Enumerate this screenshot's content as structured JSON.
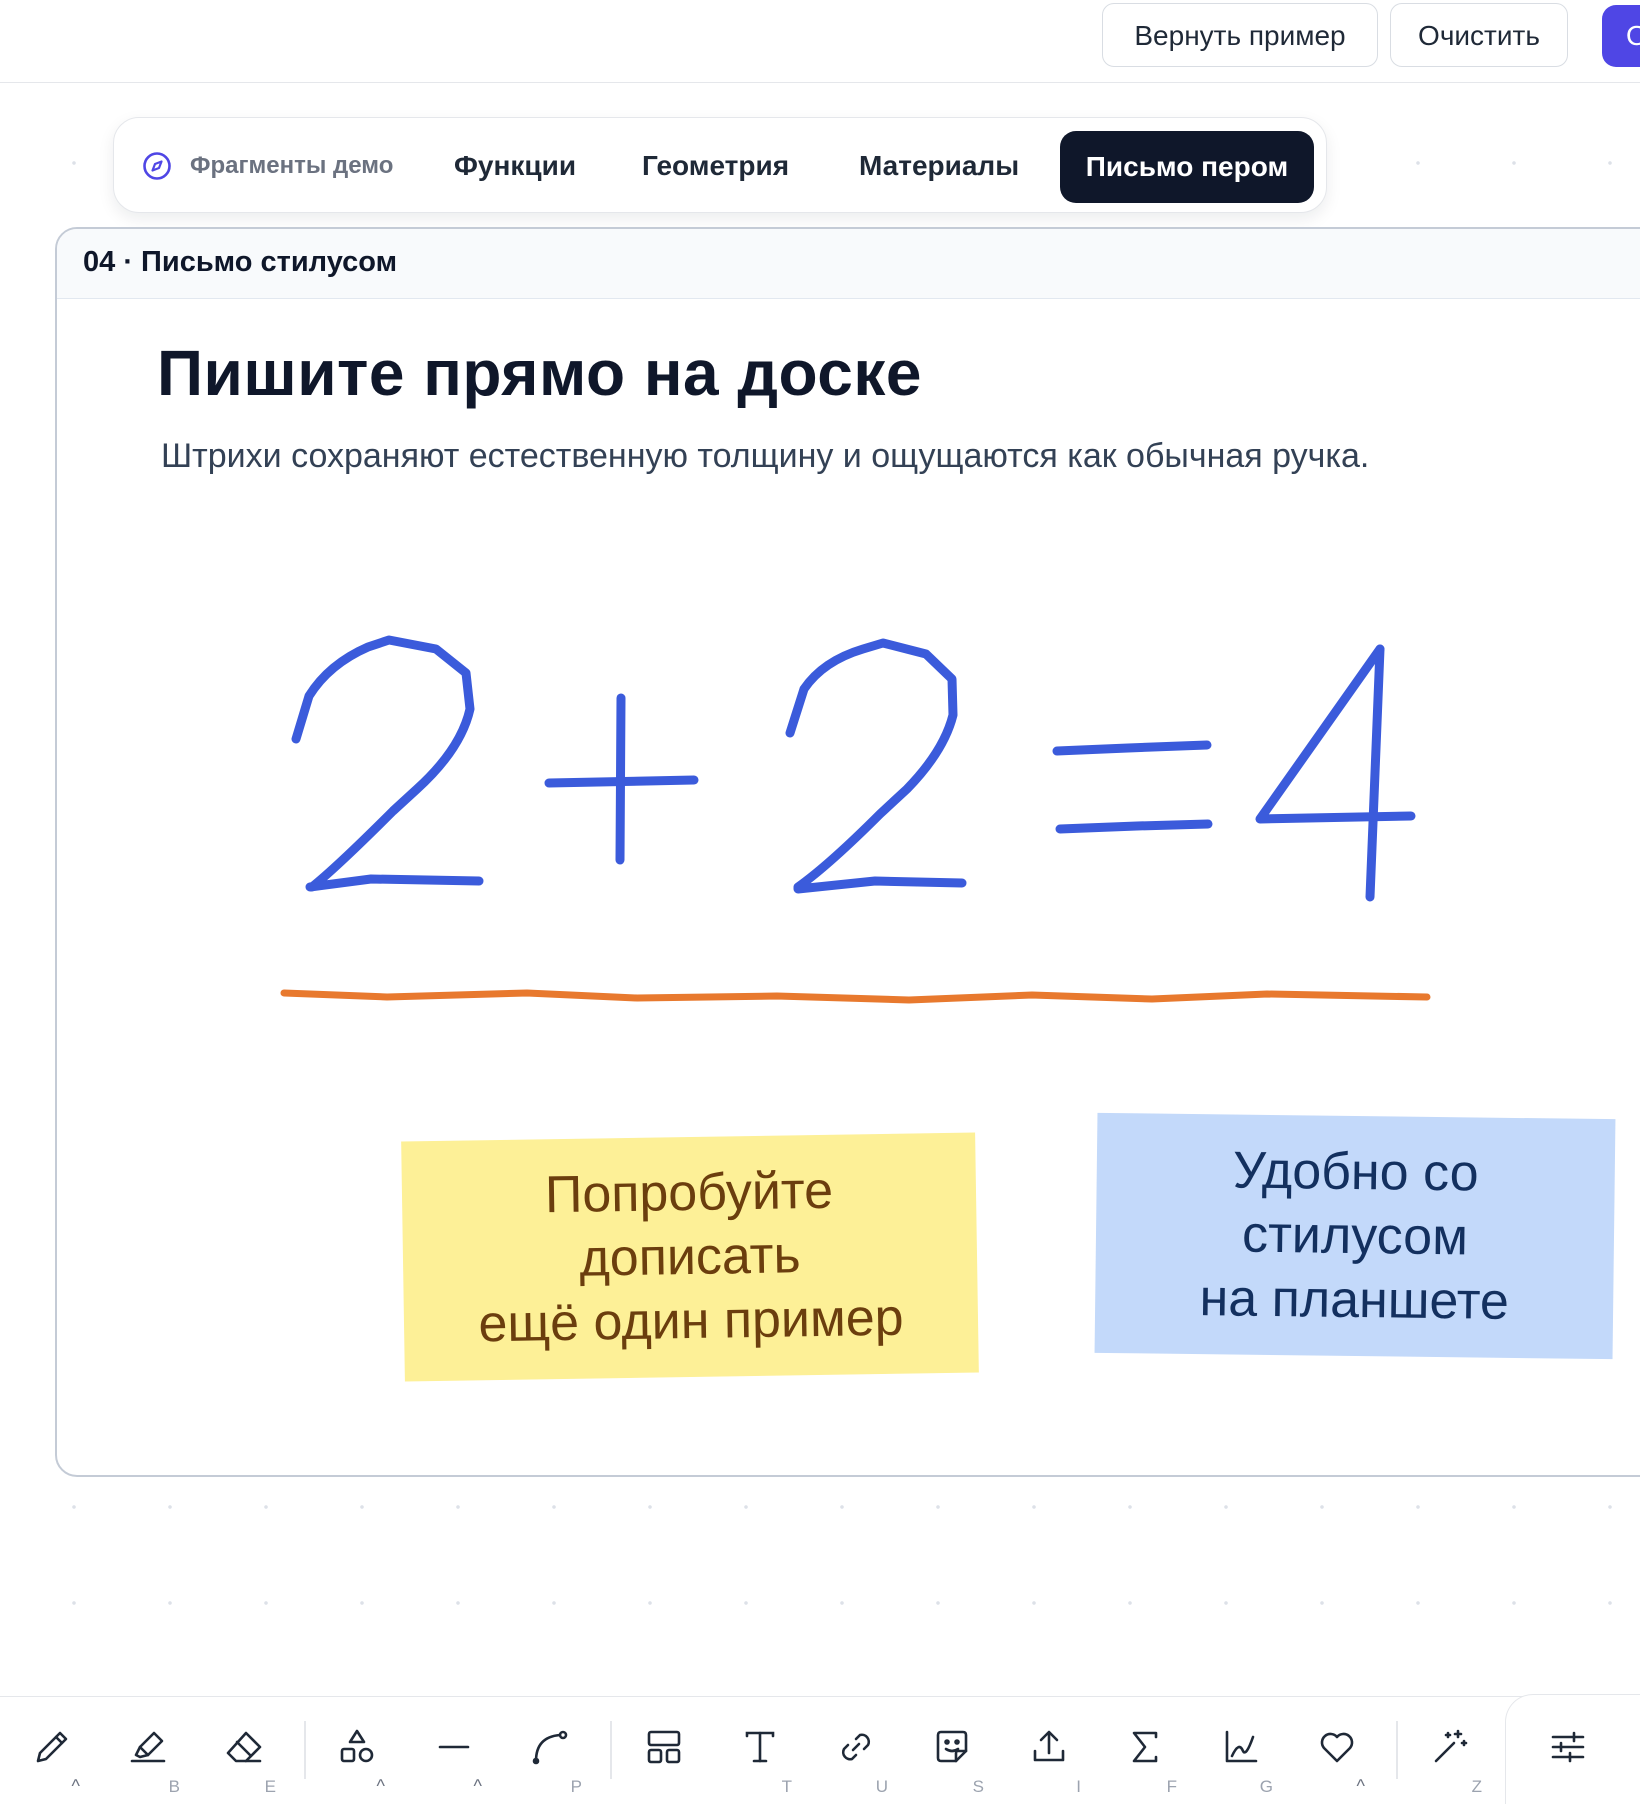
{
  "topbar": {
    "restore_label": "Вернуть пример",
    "clear_label": "Очистить",
    "primary_label": "О"
  },
  "tabs": {
    "demo": "Фрагменты демо",
    "functions": "Функции",
    "geometry": "Геометрия",
    "materials": "Материалы",
    "pen": "Письмо пером",
    "active": "pen"
  },
  "card": {
    "label": "04 · Письмо стилусом",
    "heading": "Пишите прямо на доске",
    "subheading": "Штрихи сохраняют естественную толщину и ощущаются как обычная ручка.",
    "ink_color": "#3b5bdb",
    "underline_color": "#e8792e"
  },
  "notes": {
    "yellow": "Попробуйте\nдописать\nещё один пример",
    "blue": "Удобно со\nстилусом\nна планшете",
    "yellow_bg": "#fdf097",
    "blue_bg": "#c3d9fa"
  },
  "toolbar": {
    "tools": [
      {
        "icon": "pencil-icon",
        "key": "",
        "has_caret": true
      },
      {
        "icon": "highlighter-icon",
        "key": "B",
        "has_caret": false
      },
      {
        "icon": "eraser-icon",
        "key": "E",
        "has_caret": false
      },
      {
        "icon": "shapes-icon",
        "key": "",
        "has_caret": true
      },
      {
        "icon": "line-icon",
        "key": "",
        "has_caret": true
      },
      {
        "icon": "curve-icon",
        "key": "P",
        "has_caret": false
      },
      {
        "icon": "layout-icon",
        "key": "",
        "has_caret": false
      },
      {
        "icon": "text-icon",
        "key": "T",
        "has_caret": false
      },
      {
        "icon": "link-icon",
        "key": "U",
        "has_caret": false
      },
      {
        "icon": "sticker-icon",
        "key": "S",
        "has_caret": false
      },
      {
        "icon": "upload-icon",
        "key": "I",
        "has_caret": false
      },
      {
        "icon": "sigma-icon",
        "key": "F",
        "has_caret": false
      },
      {
        "icon": "graph-icon",
        "key": "G",
        "has_caret": false
      },
      {
        "icon": "heart-icon",
        "key": "",
        "has_caret": true
      },
      {
        "icon": "magic-wand-icon",
        "key": "Z",
        "has_caret": false
      },
      {
        "icon": "sliders-icon",
        "key": "",
        "has_caret": false
      }
    ],
    "caret_glyph": "^"
  }
}
